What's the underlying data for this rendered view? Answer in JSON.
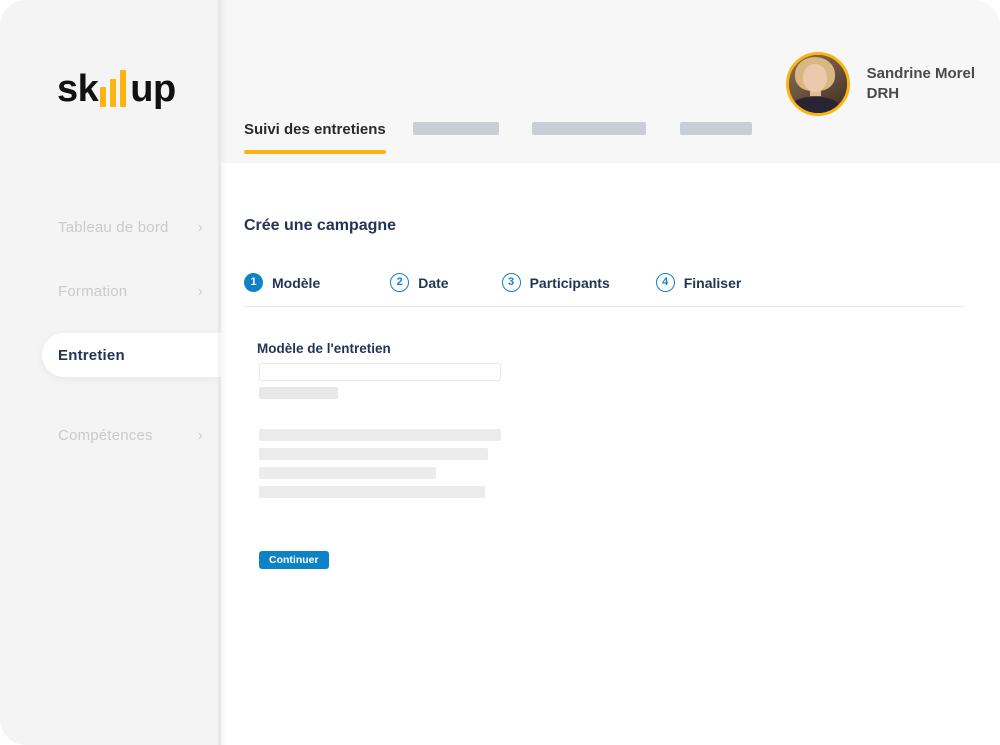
{
  "app": {
    "brand": {
      "prefix": "sk",
      "suffix": "up",
      "bar_count": 3,
      "accent_color": "#fcb415"
    }
  },
  "sidebar": {
    "items": [
      {
        "label": "Tableau de bord",
        "chevron": "chevron-right-icon",
        "active": false
      },
      {
        "label": "Formation",
        "chevron": "chevron-right-icon",
        "active": false
      },
      {
        "label": "Entretien",
        "chevron": "",
        "active": true
      },
      {
        "label": "Compétences",
        "chevron": "chevron-right-icon",
        "active": false
      }
    ],
    "chevron_glyph": "›"
  },
  "header": {
    "user": {
      "name": "Sandrine Morel",
      "role": "DRH",
      "avatar": "user-avatar-photo"
    }
  },
  "tabs": [
    {
      "label": "Suivi des entretiens",
      "active": true,
      "placeholder": false
    },
    {
      "label": "",
      "active": false,
      "placeholder": true,
      "width": 86
    },
    {
      "label": "",
      "active": false,
      "placeholder": true,
      "width": 114
    },
    {
      "label": "",
      "active": false,
      "placeholder": true,
      "width": 72
    }
  ],
  "main": {
    "page_title": "Crée une campagne",
    "stepper": [
      {
        "number": "1",
        "label": "Modèle",
        "state": "current"
      },
      {
        "number": "2",
        "label": "Date",
        "state": "upcoming"
      },
      {
        "number": "3",
        "label": "Participants",
        "state": "upcoming"
      },
      {
        "number": "4",
        "label": "Finaliser",
        "state": "upcoming"
      }
    ],
    "form": {
      "field_label": "Modèle de l'entretien",
      "field_value": "",
      "field_placeholder": ""
    },
    "continue_button": "Continuer"
  },
  "colors": {
    "accent_yellow": "#fcb415",
    "primary_blue": "#0e82c7",
    "text_navy": "#233555",
    "sidebar_bg": "#f4f4f4",
    "header_bg": "#f7f7f7",
    "skeleton_grey": "#ececec",
    "tab_placeholder_grey": "#c9ced6"
  }
}
